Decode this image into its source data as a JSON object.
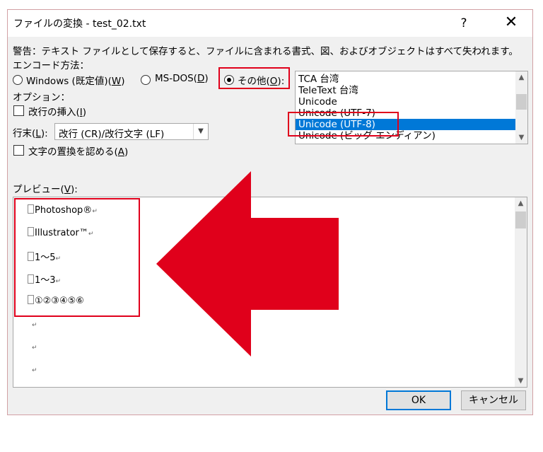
{
  "dialog": {
    "title": "ファイルの変換 - test_02.txt",
    "help_label": "?",
    "close_label": "✕"
  },
  "warning": "警告：テキスト ファイルとして保存すると、ファイルに含まれる書式、図、およびオブジェクトはすべて失われます。",
  "encoding": {
    "section_label": "エンコード方法：",
    "options": [
      {
        "label": "Windows (既定値)(",
        "key": "W",
        "suffix": ")",
        "checked": false
      },
      {
        "label": "MS-DOS(",
        "key": "D",
        "suffix": ")",
        "checked": false
      },
      {
        "label": "その他(",
        "key": "O",
        "suffix": "):",
        "checked": true
      }
    ],
    "list_items": [
      "TCA 台湾",
      "TeleText 台湾",
      "Unicode",
      "Unicode (UTF-7)",
      "Unicode (UTF-8)",
      "Unicode (ビッグ エンディアン)"
    ],
    "selected_item": "Unicode (UTF-8)"
  },
  "options": {
    "section_label": "オプション：",
    "insert_linebreak": {
      "label": "改行の挿入(",
      "key": "I",
      "suffix": ")",
      "checked": false
    },
    "line_end": {
      "label": "行末(",
      "key": "L",
      "suffix": "):",
      "value": "改行 (CR)/改行文字 (LF)"
    },
    "allow_substitution": {
      "label": "文字の置換を認める(",
      "key": "A",
      "suffix": ")",
      "checked": false
    }
  },
  "preview": {
    "label": "プレビュー(",
    "key": "V",
    "suffix": "):",
    "lines": [
      "Photoshop®",
      "Illustrator™",
      "1～5",
      "1～3",
      "①②③④⑤⑥"
    ],
    "return_mark": "↵"
  },
  "buttons": {
    "ok": "OK",
    "cancel": "キャンセル"
  },
  "colors": {
    "highlight": "#e0001b",
    "selection": "#0078d7"
  },
  "icons": {
    "help": "question-icon",
    "close": "close-icon",
    "scroll_up": "chevron-up-icon",
    "scroll_down": "chevron-down-icon",
    "arrow": "left-arrow-icon"
  }
}
